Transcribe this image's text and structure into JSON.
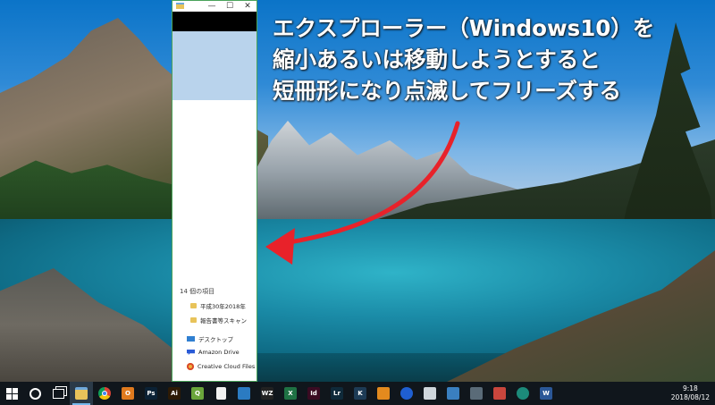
{
  "annotation": {
    "line1": "エクスプローラー（Windows10）を",
    "line2": "縮小あるいは移動しようとすると",
    "line3": "短冊形になり点滅してフリーズする",
    "arrow_color": "#e8222a"
  },
  "explorer": {
    "controls": {
      "minimize": "—",
      "maximize": "☐",
      "close": "✕"
    },
    "item_count": "14 個の項目",
    "files": [
      "平成30年2018年",
      "報告書等スキャン"
    ],
    "nav": {
      "desktop": "デスクトップ",
      "amazon": "Amazon Drive",
      "creative_cloud": "Creative Cloud Files"
    },
    "border_color": "#4aa35a"
  },
  "taskbar": {
    "apps": [
      {
        "name": "start",
        "icon": "windows-logo-icon"
      },
      {
        "name": "cortana",
        "icon": "search-circle-icon"
      },
      {
        "name": "task-view",
        "icon": "task-view-icon"
      },
      {
        "name": "file-explorer",
        "icon": "folder-icon",
        "active": true,
        "color": "#e8c35a"
      },
      {
        "name": "chrome",
        "icon": "chrome-icon"
      },
      {
        "name": "outlook",
        "icon": "outlook-icon",
        "color": "#e07a1e",
        "label": "O"
      },
      {
        "name": "photoshop",
        "icon": "photoshop-icon",
        "color": "#0b2135",
        "label": "Ps"
      },
      {
        "name": "illustrator",
        "icon": "illustrator-icon",
        "color": "#2d1a05",
        "label": "Ai"
      },
      {
        "name": "qgis",
        "icon": "qgis-icon",
        "color": "#6aa53b",
        "label": "Q"
      },
      {
        "name": "notepad",
        "icon": "document-icon",
        "color": "#f2f2f2"
      },
      {
        "name": "app-blue",
        "icon": "app-icon",
        "color": "#2b7bc2"
      },
      {
        "name": "wz",
        "icon": "wz-icon",
        "color": "#222",
        "label": "WZ"
      },
      {
        "name": "excel",
        "icon": "excel-icon",
        "color": "#1f7244",
        "label": "X"
      },
      {
        "name": "indesign",
        "icon": "indesign-icon",
        "color": "#3a0b22",
        "label": "Id"
      },
      {
        "name": "lightroom",
        "icon": "lightroom-icon",
        "color": "#0f2a3a",
        "label": "Lr"
      },
      {
        "name": "app-k",
        "icon": "app-icon",
        "color": "#1d3b55",
        "label": "K"
      },
      {
        "name": "butterfly",
        "icon": "butterfly-icon",
        "color": "#e38a1e"
      },
      {
        "name": "app-circle",
        "icon": "app-icon",
        "color": "#1f5fd1"
      },
      {
        "name": "app-cursor",
        "icon": "app-icon",
        "color": "#cfd6dc"
      },
      {
        "name": "app-chart",
        "icon": "app-icon",
        "color": "#3a7fc0"
      },
      {
        "name": "app-camera",
        "icon": "app-icon",
        "color": "#5a6b78"
      },
      {
        "name": "app-image",
        "icon": "image-icon",
        "color": "#c9463d"
      },
      {
        "name": "app-globe",
        "icon": "globe-icon",
        "color": "#1c8a7a"
      },
      {
        "name": "word",
        "icon": "word-icon",
        "color": "#2b5797",
        "label": "W"
      }
    ],
    "clock_time": "9:18",
    "clock_date": "2018/08/12"
  }
}
